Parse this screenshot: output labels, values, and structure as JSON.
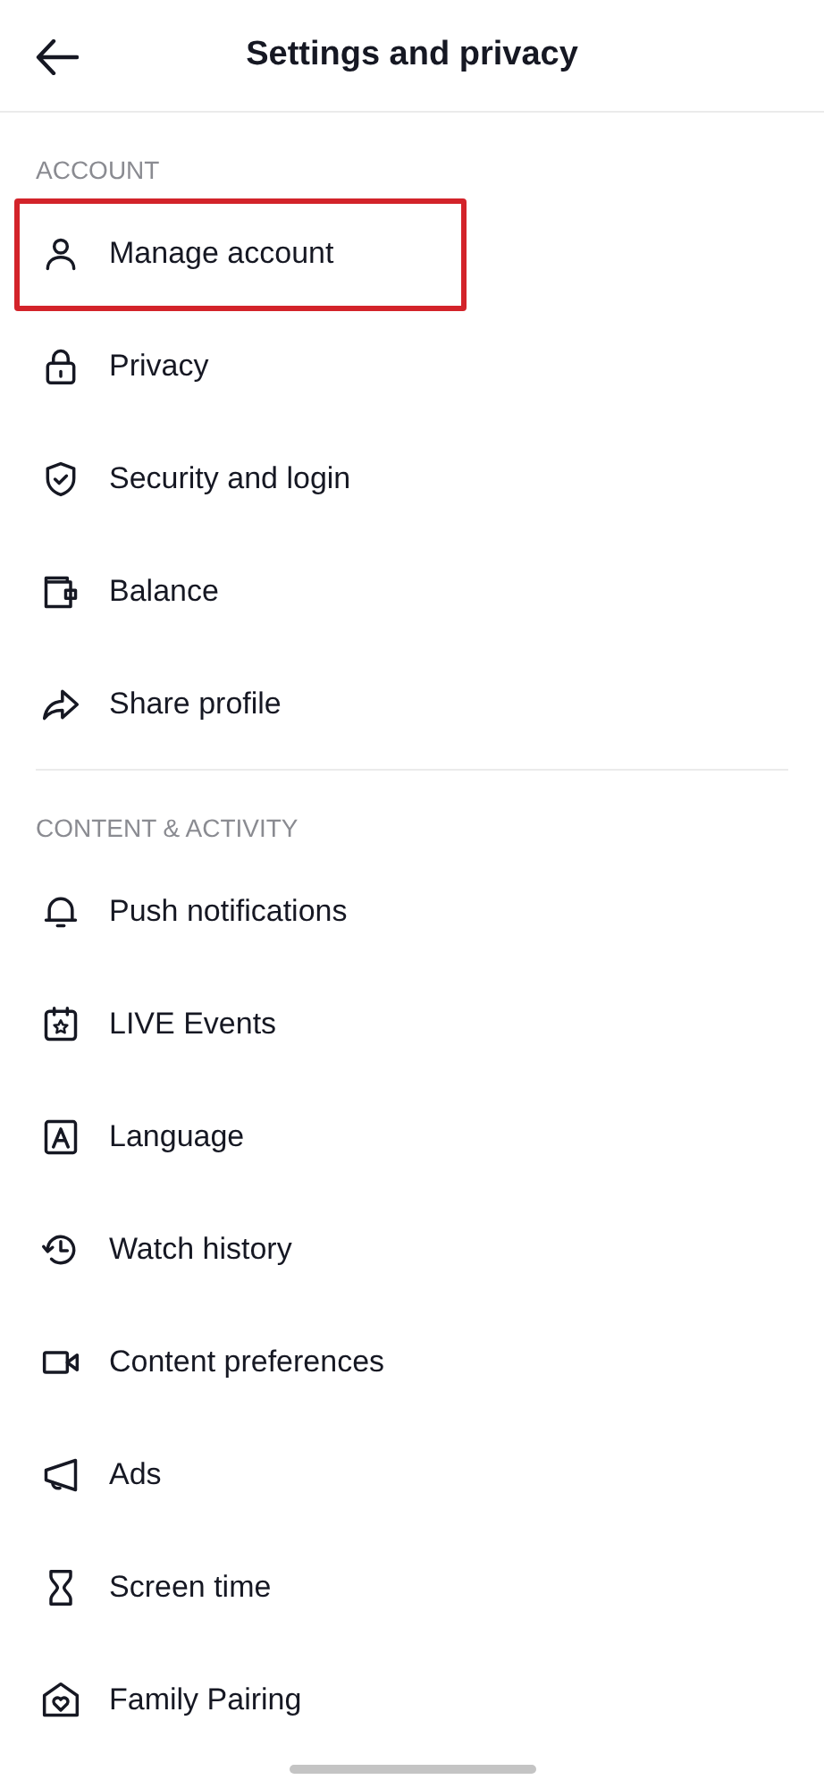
{
  "header": {
    "title": "Settings and privacy"
  },
  "sections": [
    {
      "label": "ACCOUNT",
      "items": [
        {
          "label": "Manage account",
          "highlighted": true
        },
        {
          "label": "Privacy",
          "highlighted": false
        },
        {
          "label": "Security and login",
          "highlighted": false
        },
        {
          "label": "Balance",
          "highlighted": false
        },
        {
          "label": "Share profile",
          "highlighted": false
        }
      ]
    },
    {
      "label": "CONTENT & ACTIVITY",
      "items": [
        {
          "label": "Push notifications",
          "highlighted": false
        },
        {
          "label": "LIVE Events",
          "highlighted": false
        },
        {
          "label": "Language",
          "highlighted": false
        },
        {
          "label": "Watch history",
          "highlighted": false
        },
        {
          "label": "Content preferences",
          "highlighted": false
        },
        {
          "label": "Ads",
          "highlighted": false
        },
        {
          "label": "Screen time",
          "highlighted": false
        },
        {
          "label": "Family Pairing",
          "highlighted": false
        }
      ]
    }
  ]
}
